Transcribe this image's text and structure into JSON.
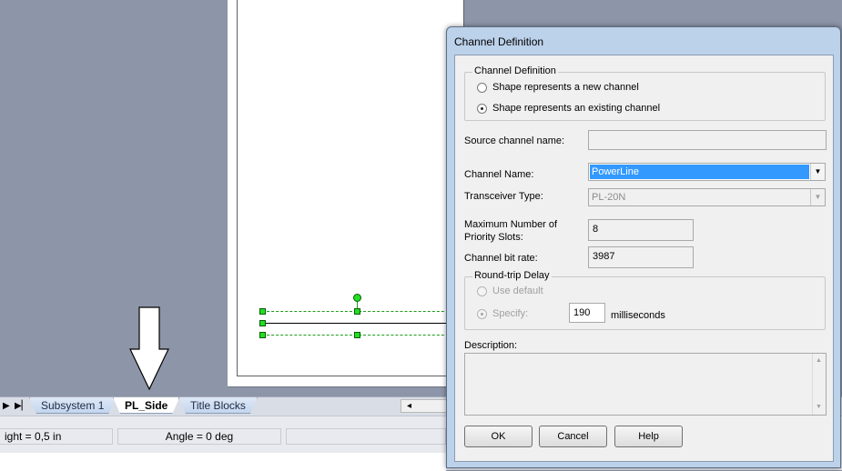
{
  "tab_bar": {
    "tabs": [
      "Subsystem 1",
      "PL_Side",
      "Title Blocks"
    ],
    "active_tab": "PL_Side",
    "nav_first": "▶",
    "nav_last": "▶▏",
    "scroll_left": "◂"
  },
  "status_bar": {
    "height_text": "ight = 0,5 in",
    "angle_text": "Angle = 0 deg"
  },
  "dialog": {
    "title": "Channel Definition",
    "group_channel_definition": {
      "legend": "Channel Definition",
      "option_new": "Shape represents a new channel",
      "option_existing": "Shape represents an existing channel",
      "selected": "existing"
    },
    "source_channel_name_label": "Source channel name:",
    "source_channel_name_value": "",
    "channel_name_label": "Channel Name:",
    "channel_name_value": "PowerLine",
    "transceiver_type_label": "Transceiver Type:",
    "transceiver_type_value": "PL-20N",
    "max_priority_slots_label_1": "Maximum  Number of",
    "max_priority_slots_label_2": "Priority Slots:",
    "max_priority_slots_value": "8",
    "channel_bit_rate_label": "Channel bit rate:",
    "channel_bit_rate_value": "3987",
    "group_round_trip": {
      "legend": "Round-trip Delay",
      "option_default": "Use default",
      "option_specify": "Specify:",
      "specify_value": "190",
      "units": "milliseconds"
    },
    "description_label": "Description:",
    "description_value": "",
    "buttons": {
      "ok": "OK",
      "cancel": "Cancel",
      "help": "Help"
    },
    "scroll_up": "▲",
    "scroll_down": "▼",
    "dropdown_arrow": "▼"
  },
  "icons": {
    "down_arrow": "down-arrow-annotation",
    "left_arrow": "left-arrow-annotation"
  },
  "colors": {
    "canvas_bg": "#8d95a8",
    "selection_handle": "#20e020",
    "selected_combo": "#3399ff",
    "dialog_frame": "#bcd1ea"
  }
}
